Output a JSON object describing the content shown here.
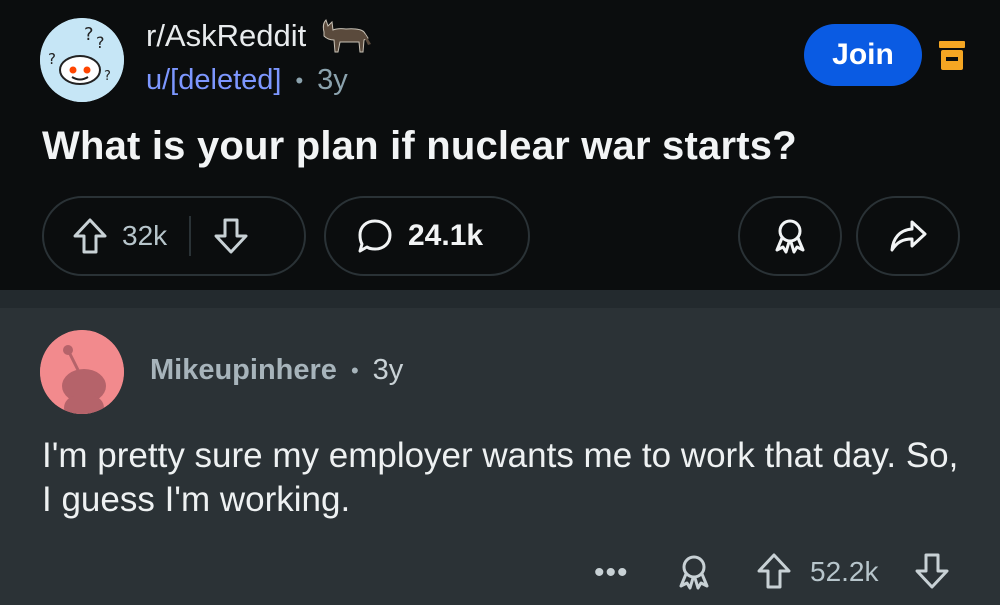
{
  "post": {
    "subreddit": "r/AskReddit",
    "author": "u/[deleted]",
    "separator": "•",
    "age": "3y",
    "title": "What is your plan if nuclear war starts?",
    "join_label": "Join",
    "upvotes": "32k",
    "comments": "24.1k"
  },
  "comment": {
    "author": "Mikeupinhere",
    "separator": "•",
    "age": "3y",
    "body": "I'm pretty sure my employer wants me to work that day. So, I guess I'm working.",
    "more": "•••",
    "score": "52.2k"
  },
  "colors": {
    "accent": "#0a5be3",
    "username": "#7d97ff",
    "mod_icon": "#f5a623"
  },
  "icons": [
    "reddit-snoo-question-icon",
    "donkey-flair-icon",
    "mod-shield-icon",
    "upvote-icon",
    "downvote-icon",
    "comment-bubble-icon",
    "award-icon",
    "share-icon",
    "more-icon",
    "snoo-avatar-icon"
  ]
}
